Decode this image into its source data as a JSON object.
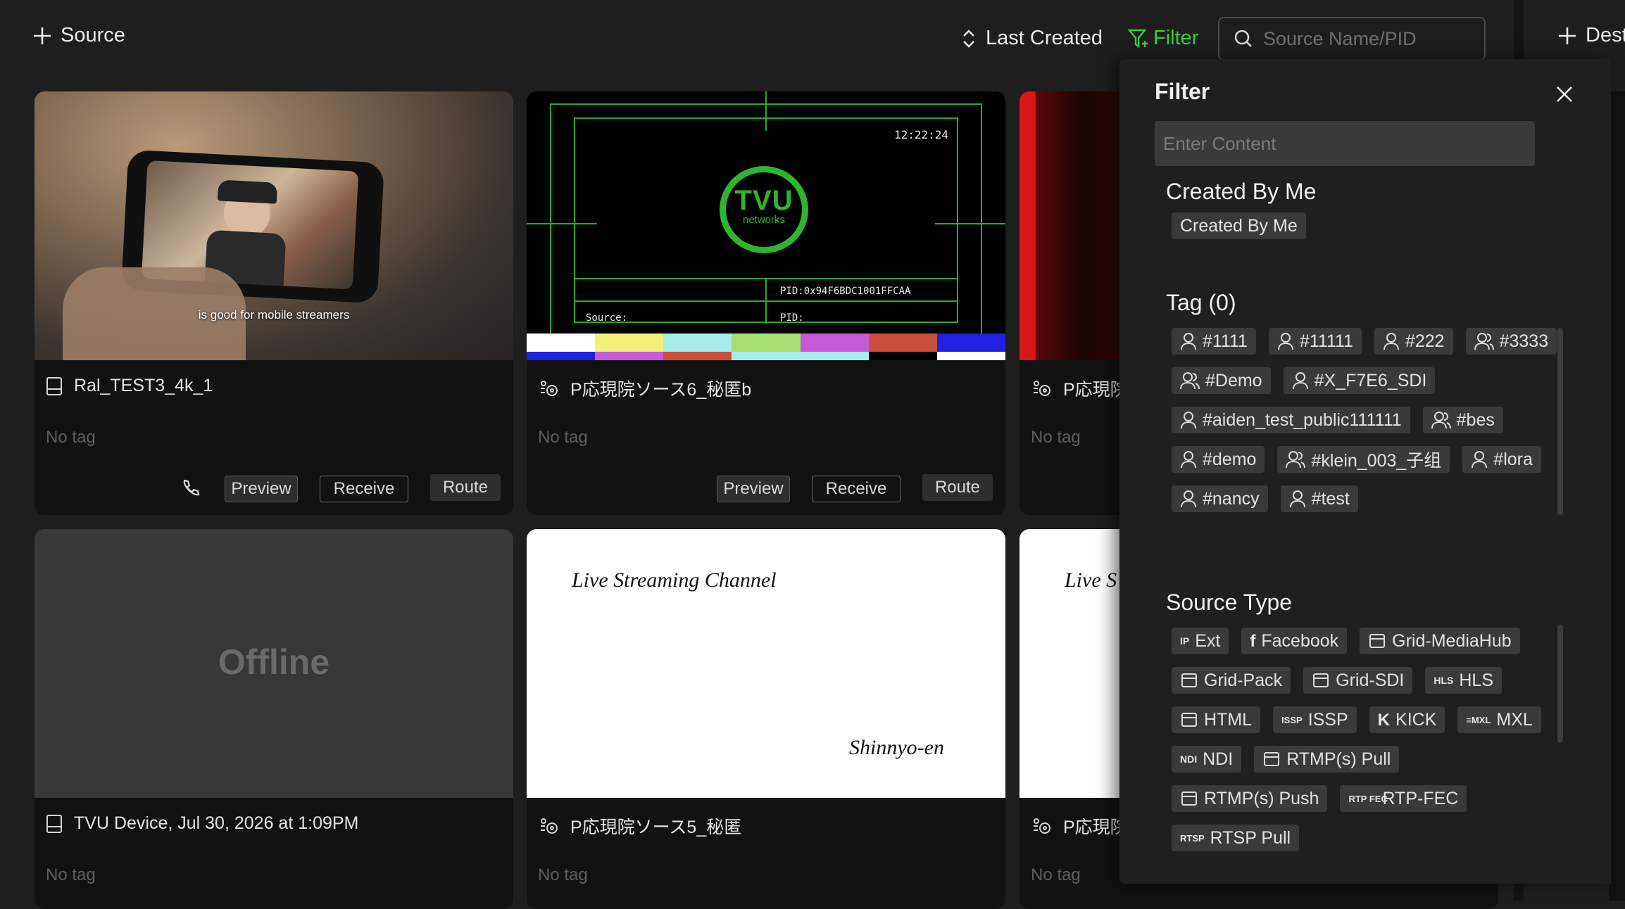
{
  "topbar": {
    "add_source_label": "Source",
    "sort_label": "Last Created",
    "filter_label": "Filter",
    "search_placeholder": "Source Name/PID",
    "add_destination_label": "Dest"
  },
  "cards": [
    {
      "title": "Ral_TEST3_4k_1",
      "tag_text": "No tag",
      "thumb_caption": "is good for mobile streamers",
      "preview_label": "Preview",
      "receive_label": "Receive",
      "route_label": "Route"
    },
    {
      "title": "P応現院ソース6_秘匿b",
      "tag_text": "No tag",
      "clock": "12:22:24",
      "logo_text": "TVU",
      "logo_sub": "networks",
      "pid_line": "PID:0x94F6BDC1001FFCAA",
      "source_label": "Source:",
      "pid_label": "PID:",
      "preview_label": "Preview",
      "receive_label": "Receive",
      "route_label": "Route"
    },
    {
      "title": "P応現院",
      "tag_text": "No tag"
    },
    {
      "title": "TVU Device, Jul 30, 2026 at 1:09PM",
      "tag_text": "No tag",
      "status": "Offline"
    },
    {
      "title": "P応現院ソース5_秘匿",
      "tag_text": "No tag",
      "channel_text": "Live Streaming Channel",
      "signature_text": "Shinnyo-en"
    },
    {
      "title": "P応現院",
      "tag_text": "No tag",
      "channel_text": "Live S"
    }
  ],
  "filter_panel": {
    "title": "Filter",
    "search_placeholder": "Enter Content",
    "created_by_me": {
      "heading": "Created By Me",
      "chip": "Created By Me"
    },
    "tags": {
      "heading": "Tag (0)",
      "items": [
        {
          "label": "#1111",
          "icon": "user-icon"
        },
        {
          "label": "#11111",
          "icon": "user-icon"
        },
        {
          "label": "#222",
          "icon": "user-icon"
        },
        {
          "label": "#3333",
          "icon": "users-icon"
        },
        {
          "label": "#Demo",
          "icon": "users-icon"
        },
        {
          "label": "#X_F7E6_SDI",
          "icon": "user-icon"
        },
        {
          "label": "#aiden_test_public111111",
          "icon": "user-icon"
        },
        {
          "label": "#bes",
          "icon": "users-icon"
        },
        {
          "label": "#demo",
          "icon": "user-icon"
        },
        {
          "label": "#klein_003_子组",
          "icon": "users-icon"
        },
        {
          "label": "#lora",
          "icon": "user-icon"
        },
        {
          "label": "#nancy",
          "icon": "user-icon"
        },
        {
          "label": "#test",
          "icon": "user-icon"
        }
      ]
    },
    "source_types": {
      "heading": "Source Type",
      "items": [
        {
          "label": "Ext",
          "icon": "ip-icon",
          "glyph": "IP"
        },
        {
          "label": "Facebook",
          "icon": "facebook-icon",
          "glyph": "f"
        },
        {
          "label": "Grid-MediaHub",
          "icon": "mediahub-icon",
          "glyph": ""
        },
        {
          "label": "Grid-Pack",
          "icon": "grid-pack-icon",
          "glyph": ""
        },
        {
          "label": "Grid-SDI",
          "icon": "grid-sdi-icon",
          "glyph": ""
        },
        {
          "label": "HLS",
          "icon": "hls-icon",
          "glyph": "HLS"
        },
        {
          "label": "HTML",
          "icon": "html-icon",
          "glyph": ""
        },
        {
          "label": "ISSP",
          "icon": "issp-icon",
          "glyph": "ISSP"
        },
        {
          "label": "KICK",
          "icon": "kick-icon",
          "glyph": "K"
        },
        {
          "label": "MXL",
          "icon": "mxl-icon",
          "glyph": "≡MXL"
        },
        {
          "label": "NDI",
          "icon": "ndi-icon",
          "glyph": "NDI"
        },
        {
          "label": "RTMP(s) Pull",
          "icon": "rtmp-pull-icon",
          "glyph": ""
        },
        {
          "label": "RTMP(s) Push",
          "icon": "rtmp-push-icon",
          "glyph": ""
        },
        {
          "label": "RTP-FEC",
          "icon": "rtp-fec-icon",
          "glyph": "RTP FEC"
        },
        {
          "label": "RTSP Pull",
          "icon": "rtsp-pull-icon",
          "glyph": "RTSP"
        }
      ]
    }
  },
  "colors": {
    "accent_green": "#3ec93e",
    "panel_bg": "#1f1f20",
    "chip_bg": "#3a3a3b"
  }
}
